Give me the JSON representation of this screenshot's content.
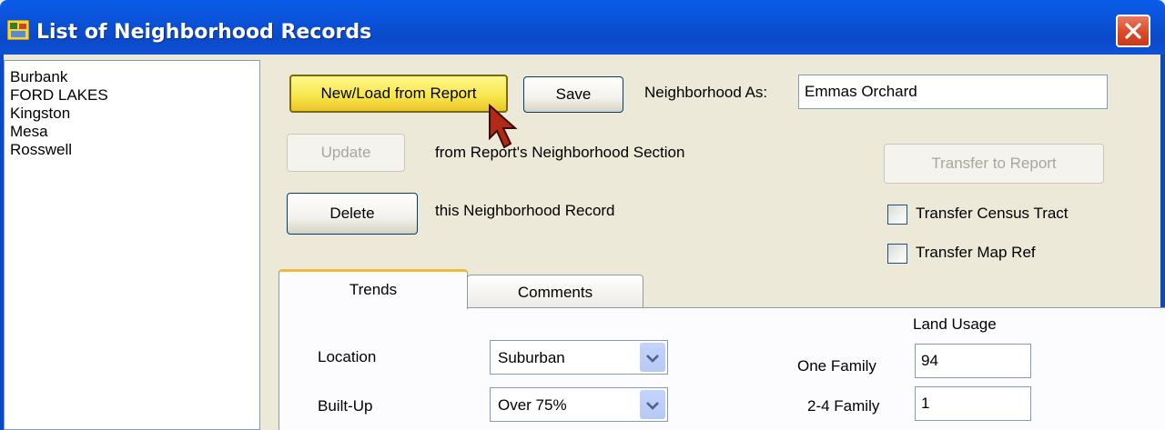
{
  "window": {
    "title": "List of Neighborhood Records",
    "accent": "#0a52d8"
  },
  "neighborhood_list": {
    "items": [
      "Burbank",
      "FORD LAKES",
      "Kingston",
      "Mesa",
      "Rosswell"
    ]
  },
  "toolbar": {
    "new_load_label": "New/Load from Report",
    "save_label": "Save",
    "neighborhood_as_label": "Neighborhood As:",
    "neighborhood_as_value": "Emmas Orchard",
    "update_label": "Update",
    "update_caption": "from Report's Neighborhood Section",
    "delete_label": "Delete",
    "delete_caption": "this Neighborhood Record",
    "transfer_label": "Transfer to Report",
    "transfer_census_label": "Transfer Census Tract",
    "transfer_census_checked": false,
    "transfer_map_label": "Transfer Map Ref",
    "transfer_map_checked": false
  },
  "tabs": [
    {
      "label": "Trends",
      "active": true
    },
    {
      "label": "Comments",
      "active": false
    }
  ],
  "trends": {
    "location_label": "Location",
    "location_value": "Suburban",
    "builtup_label": "Built-Up",
    "builtup_value": "Over 75%",
    "land_usage_header": "Land Usage",
    "one_family_label": "One Family",
    "one_family_value": "94",
    "two_four_family_label": "2-4 Family",
    "two_four_family_value": "1"
  }
}
